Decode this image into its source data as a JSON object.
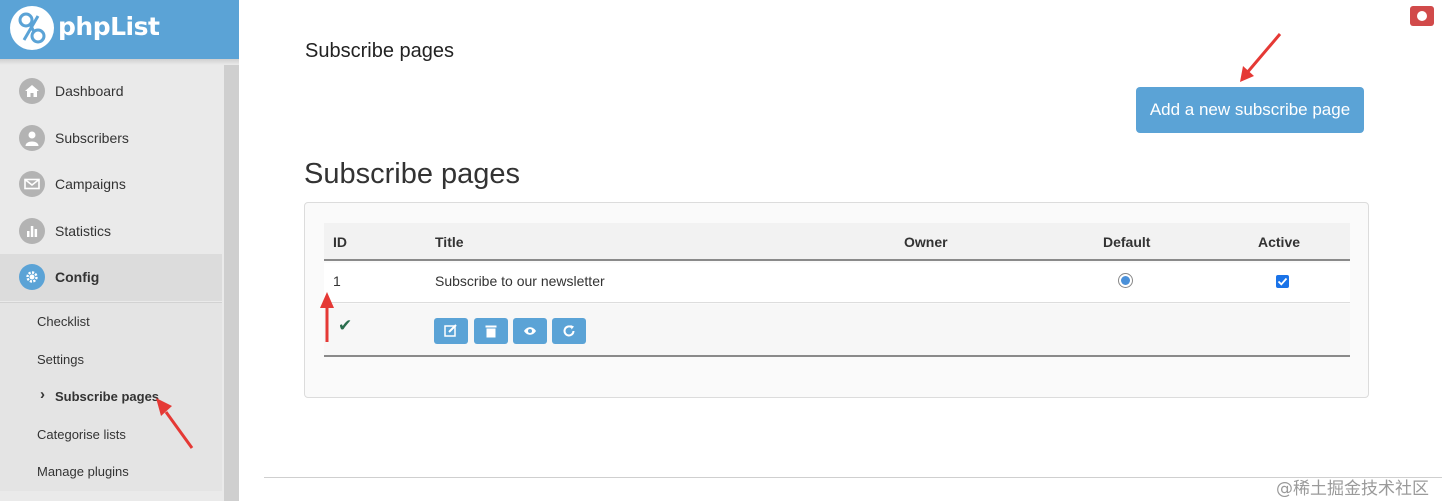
{
  "brand": {
    "name": "phpList"
  },
  "sidebar": {
    "items": [
      {
        "label": "Dashboard",
        "icon": "home-icon"
      },
      {
        "label": "Subscribers",
        "icon": "user-icon"
      },
      {
        "label": "Campaigns",
        "icon": "envelope-icon"
      },
      {
        "label": "Statistics",
        "icon": "bar-chart-icon"
      },
      {
        "label": "Config",
        "icon": "gear-icon",
        "active": true
      }
    ],
    "subitems": [
      {
        "label": "Checklist"
      },
      {
        "label": "Settings"
      },
      {
        "label": "Subscribe pages",
        "current": true
      },
      {
        "label": "Categorise lists"
      },
      {
        "label": "Manage plugins"
      }
    ]
  },
  "header": {
    "title": "Subscribe pages",
    "info_icon": "info-icon"
  },
  "main": {
    "add_button": "Add a new subscribe page",
    "section_title": "Subscribe pages",
    "table": {
      "headers": [
        "ID",
        "Title",
        "Owner",
        "Default",
        "Active"
      ],
      "rows": [
        {
          "id": "1",
          "title": "Subscribe to our newsletter",
          "owner": "",
          "default": true,
          "active": true
        }
      ],
      "row_actions": [
        "edit-icon",
        "trash-icon",
        "eye-icon",
        "refresh-icon"
      ]
    }
  },
  "watermark": "@稀土掘金技术社区",
  "colors": {
    "accent": "#5ba3d6",
    "danger": "#d14a4a",
    "annotation": "#e53935"
  }
}
